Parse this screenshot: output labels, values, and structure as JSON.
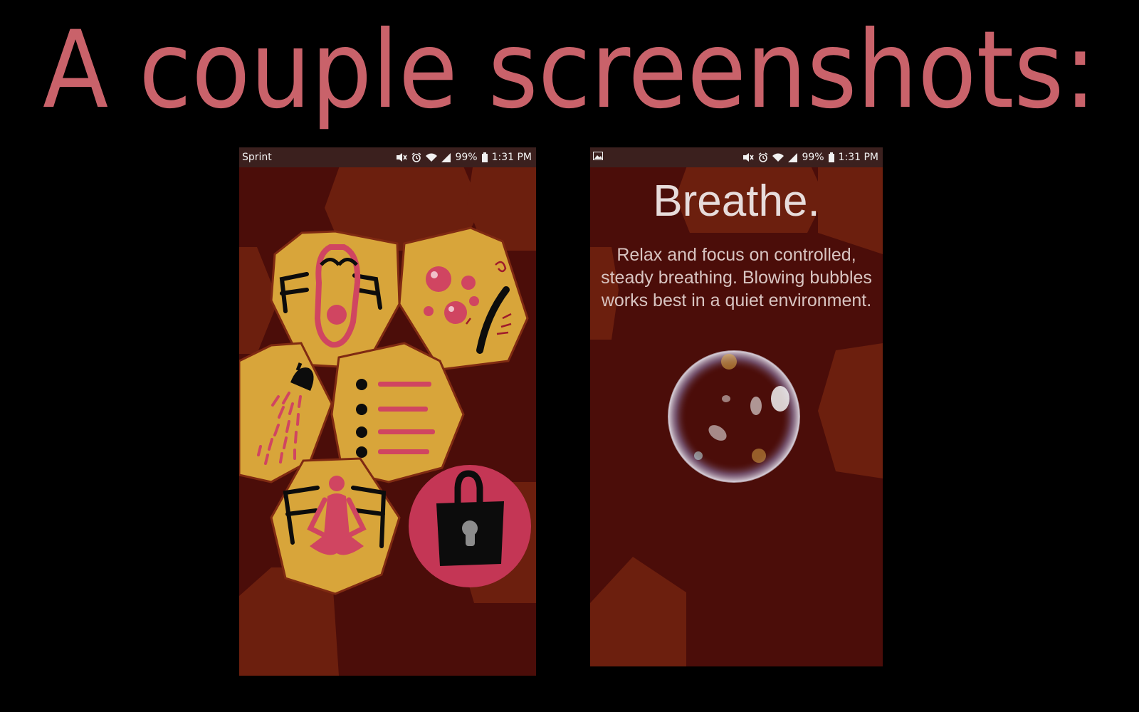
{
  "banner": {
    "title": "A couple screenshots:"
  },
  "phone_left": {
    "status": {
      "carrier": "Sprint",
      "battery": "99%",
      "time": "1:31 PM"
    },
    "menu": [
      {
        "icon": "stretching-figure-icon"
      },
      {
        "icon": "bubbles-feather-icon"
      },
      {
        "icon": "shower-icon"
      },
      {
        "icon": "checklist-icon"
      },
      {
        "icon": "meditation-figure-icon"
      },
      {
        "icon": "lock-icon"
      }
    ]
  },
  "phone_right": {
    "status": {
      "battery": "99%",
      "time": "1:31 PM"
    },
    "title": "Breathe.",
    "body": "Relax and focus on controlled, steady breathing. Blowing bubbles works best in a quiet environment."
  },
  "colors": {
    "background": "#000000",
    "banner_text": "#c9626a",
    "screen_dark": "#4b0d09",
    "screen_hex": "#6c1f0e",
    "tile_gold": "#d8a53a",
    "accent_pink": "#d04561",
    "status_bar": "#3b201e"
  }
}
